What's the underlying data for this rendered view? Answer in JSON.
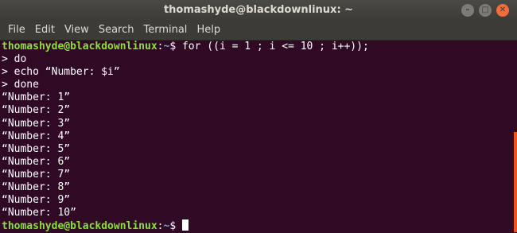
{
  "window": {
    "title": "thomashyde@blackdownlinux: ~",
    "controls": {
      "minimize": "–",
      "maximize": "□",
      "close": "✕"
    }
  },
  "menu": [
    "File",
    "Edit",
    "View",
    "Search",
    "Terminal",
    "Help"
  ],
  "prompt": {
    "user_host": "thomashyde@blackdownlinux",
    "colon": ":",
    "path": "~",
    "symbol": "$ "
  },
  "command": "for ((i = 1 ; i <= 10 ; i++));",
  "continuation_lines": [
    "> do",
    "> echo “Number: $i”",
    "> done"
  ],
  "output_lines": [
    "“Number: 1”",
    "“Number: 2”",
    "“Number: 3”",
    "“Number: 4”",
    "“Number: 5”",
    "“Number: 6”",
    "“Number: 7”",
    "“Number: 8”",
    "“Number: 9”",
    "“Number: 10”"
  ],
  "colors": {
    "background": "#300a24",
    "user_host": "#8ae234",
    "path": "#729fcf",
    "text": "#ffffff",
    "scrollbar_accent": "#e95420",
    "close_button": "#f46d3c"
  }
}
